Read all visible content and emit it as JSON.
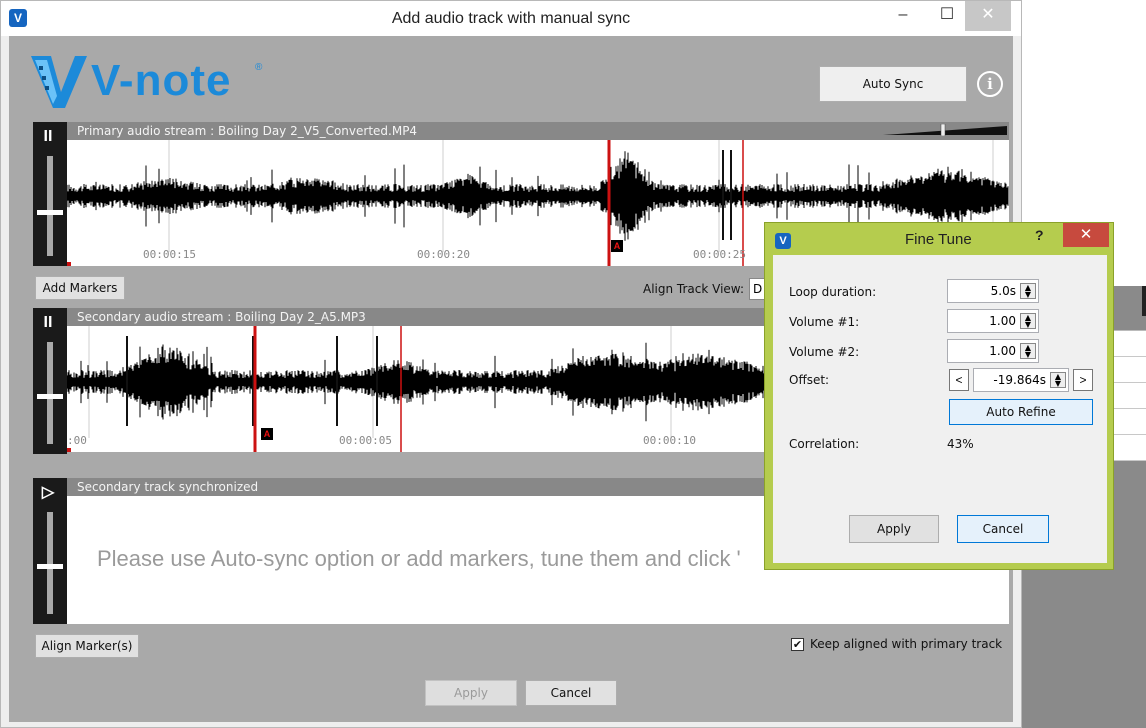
{
  "window": {
    "title": "Add audio track with manual sync",
    "minimize_glyph": "–",
    "maximize_glyph": "☐",
    "close_glyph": "✕"
  },
  "logo": {
    "text": "V-note",
    "reg": "®"
  },
  "toolbar": {
    "auto_sync": "Auto Sync",
    "info_glyph": "i"
  },
  "primary": {
    "title": "Primary audio stream : Boiling Day 2_V5_Converted.MP4",
    "timecodes": [
      "00:00:15",
      "00:00:20",
      "00:00:25"
    ],
    "marker": "A",
    "control_glyph": "II"
  },
  "middle_bar": {
    "add_markers": "Add Markers",
    "align_view_label": "Align Track View:",
    "align_view_value": "D"
  },
  "secondary": {
    "title": "Secondary audio stream : Boiling Day 2_A5.MP3",
    "timecodes": [
      ":00",
      "00:00:05",
      "00:00:10"
    ],
    "marker": "A",
    "control_glyph": "II"
  },
  "synced": {
    "title": "Secondary track synchronized",
    "control_glyph": "▷",
    "placeholder": "Please use Auto-sync option or add markers, tune them and click '"
  },
  "bottom": {
    "align_markers": "Align Marker(s)",
    "keep_aligned": "Keep aligned with primary track",
    "keep_aligned_checked": "✔",
    "apply": "Apply",
    "cancel": "Cancel"
  },
  "fine_tune": {
    "title": "Fine Tune",
    "help_glyph": "?",
    "close_glyph": "✕",
    "loop_label": "Loop duration:",
    "loop_value": "5.0s",
    "vol1_label": "Volume #1:",
    "vol1_value": "1.00",
    "vol2_label": "Volume #2:",
    "vol2_value": "1.00",
    "offset_label": "Offset:",
    "offset_value": "-19.864s",
    "prev": "<",
    "next": ">",
    "auto_refine": "Auto Refine",
    "correlation_label": "Correlation:",
    "correlation_value": "43%",
    "apply": "Apply",
    "cancel": "Cancel"
  },
  "colors": {
    "accent": "#1c8ad9",
    "dialog_frame": "#b5cc4e",
    "marker_red": "#cc1111",
    "close_red": "#c74a3e"
  }
}
